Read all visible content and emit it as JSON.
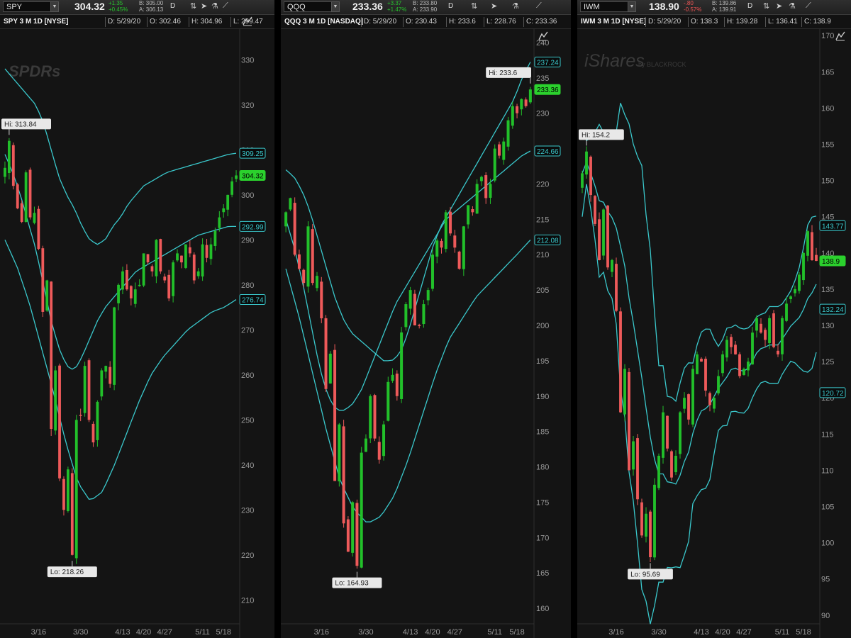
{
  "colors": {
    "up": "#22c02a",
    "down": "#ee5a5a",
    "band": "#3ac8cc",
    "bg": "#141414",
    "axis_text": "#9a9a9a"
  },
  "panels": [
    {
      "symbol": "SPY",
      "last": "304.32",
      "change": "+1.35",
      "change_pct": "+0.45%",
      "bid": "B: 305.00",
      "ask": "A: 306.13",
      "aggregation": "D",
      "title": "SPY 3 M 1D [NYSE]",
      "date": "D: 5/29/20",
      "open": "O: 302.46",
      "high": "H: 304.96",
      "low": "L: 299.47",
      "logo": "SPDRs",
      "hi_label": "Hi: 313.84",
      "lo_label": "Lo: 218.26",
      "price_badges": [
        {
          "value": "309.25",
          "type": "band"
        },
        {
          "value": "304.32",
          "type": "last"
        },
        {
          "value": "292.99",
          "type": "band"
        },
        {
          "value": "276.74",
          "type": "band"
        }
      ]
    },
    {
      "symbol": "QQQ",
      "last": "233.36",
      "change": "+3.37",
      "change_pct": "+1.47%",
      "bid": "B: 233.80",
      "ask": "A: 233.90",
      "aggregation": "D",
      "title": "QQQ 3 M 1D [NASDAQ]",
      "date": "D: 5/29/20",
      "open": "O: 230.43",
      "high": "H: 233.6",
      "low": "L: 228.76",
      "close": "C: 233.36",
      "hi_label": "Hi: 233.6",
      "lo_label": "Lo: 164.93",
      "price_badges": [
        {
          "value": "237.24",
          "type": "band"
        },
        {
          "value": "233.36",
          "type": "last"
        },
        {
          "value": "224.66",
          "type": "band"
        },
        {
          "value": "212.08",
          "type": "band"
        }
      ]
    },
    {
      "symbol": "IWM",
      "last": "138.90",
      "change": "-.80",
      "change_pct": "-0.57%",
      "bid": "B: 139.86",
      "ask": "A: 139.91",
      "aggregation": "D",
      "title": "IWM 3 M 1D [NYSE]",
      "date": "D: 5/29/20",
      "open": "O: 138.3",
      "high": "H: 139.28",
      "low": "L: 136.41",
      "close": "C: 138.9",
      "logo": "iShares",
      "logo_sub": "by BLACKROCK",
      "hi_label": "Hi: 154.2",
      "lo_label": "Lo: 95.69",
      "price_badges": [
        {
          "value": "143.77",
          "type": "band"
        },
        {
          "value": "138.9",
          "type": "last"
        },
        {
          "value": "132.24",
          "type": "band"
        },
        {
          "value": "120.72",
          "type": "band"
        }
      ]
    }
  ],
  "chart_data": [
    {
      "type": "candlestick",
      "title": "SPY 3 M 1D [NYSE]",
      "x_ticks": [
        "3/16",
        "3/30",
        "4/13",
        "4/20",
        "4/27",
        "5/11",
        "5/18"
      ],
      "x_tick_index": [
        8,
        18,
        28,
        33,
        38,
        47,
        52
      ],
      "y_ticks": [
        210,
        220,
        230,
        240,
        250,
        260,
        270,
        280,
        290,
        300,
        310,
        320,
        330
      ],
      "ylim": [
        205,
        337
      ],
      "n_bars": 56,
      "close": [
        306,
        312,
        302,
        297,
        294,
        305,
        295,
        296,
        288,
        274,
        281,
        248,
        261,
        237,
        230,
        239,
        220,
        250,
        251,
        262,
        250,
        245,
        254,
        261,
        262,
        258,
        275,
        280,
        283,
        279,
        277,
        279,
        280,
        287,
        285,
        283,
        290,
        283,
        281,
        277,
        285,
        287,
        285,
        289,
        287,
        281,
        283,
        289,
        286,
        289,
        292,
        295,
        297,
        300,
        303,
        304.32
      ],
      "upper_band": [
        328,
        326,
        324,
        322,
        320,
        316,
        310,
        304,
        300,
        297,
        293,
        290,
        289,
        290,
        293,
        295,
        298,
        300,
        302,
        303,
        304,
        305,
        305.5,
        306,
        306.5,
        307,
        307.5,
        308,
        308.5,
        309,
        309.25
      ],
      "middle_band": [
        309,
        305,
        300,
        294,
        288,
        280,
        272,
        266,
        262,
        261,
        264,
        268,
        272,
        275,
        277,
        279,
        281,
        283,
        284,
        285,
        286,
        287,
        288,
        289,
        290,
        291,
        291.5,
        292,
        292.5,
        293,
        292.99
      ],
      "lower_band": [
        290,
        284,
        276,
        266,
        256,
        245,
        236,
        232,
        234,
        240,
        247,
        254,
        260,
        264,
        267,
        270,
        272,
        274,
        275,
        276.74
      ]
    },
    {
      "type": "candlestick",
      "title": "QQQ 3 M 1D [NASDAQ]",
      "x_ticks": [
        "3/16",
        "3/30",
        "4/13",
        "4/20",
        "4/27",
        "5/11",
        "5/18"
      ],
      "x_tick_index": [
        8,
        18,
        28,
        33,
        38,
        47,
        52
      ],
      "y_ticks": [
        160,
        165,
        170,
        175,
        180,
        185,
        190,
        195,
        200,
        205,
        210,
        215,
        220,
        225,
        230,
        235,
        240
      ],
      "ylim": [
        158,
        242
      ],
      "n_bars": 56,
      "close": [
        216,
        218,
        210,
        208,
        206,
        214,
        206,
        207,
        201,
        191,
        196,
        178,
        186,
        172,
        168,
        175,
        166,
        182,
        184,
        190,
        184,
        181,
        186,
        192,
        193,
        190,
        199,
        203,
        205,
        200,
        200,
        203,
        205,
        210,
        212,
        211,
        216,
        213,
        211,
        208,
        214,
        217,
        216,
        220,
        221,
        218,
        220,
        225,
        224,
        226,
        229,
        231,
        230,
        232,
        231,
        233.36
      ],
      "upper_band": [
        222,
        221,
        219,
        216,
        212,
        208,
        204,
        201,
        199,
        198,
        197,
        196,
        195,
        195,
        196,
        199,
        203,
        207,
        211,
        214,
        216,
        218,
        220,
        222,
        224,
        226,
        228,
        230,
        232,
        235,
        237.24
      ],
      "middle_band": [
        215,
        211,
        206,
        200,
        194,
        190,
        188,
        188,
        189,
        191,
        194,
        197,
        200,
        203,
        205,
        207,
        209,
        211,
        213,
        215,
        216,
        217,
        218,
        219,
        220,
        221,
        222,
        223,
        224,
        224.66
      ],
      "lower_band": [
        208,
        201,
        193,
        185,
        178,
        174,
        172,
        173,
        176,
        181,
        187,
        193,
        198,
        201,
        204,
        206,
        208,
        210,
        212.08
      ]
    },
    {
      "type": "candlestick",
      "title": "IWM 3 M 1D [NYSE]",
      "x_ticks": [
        "3/16",
        "3/30",
        "4/13",
        "4/20",
        "4/27",
        "5/11",
        "5/18"
      ],
      "x_tick_index": [
        8,
        18,
        28,
        33,
        38,
        47,
        52
      ],
      "y_ticks": [
        90,
        95,
        100,
        105,
        110,
        115,
        120,
        125,
        130,
        135,
        140,
        145,
        150,
        155,
        160,
        165,
        170
      ],
      "ylim": [
        89,
        171
      ],
      "n_bars": 56,
      "close": [
        151,
        154,
        148,
        144,
        139,
        146,
        138,
        139,
        132,
        118,
        124,
        110,
        114,
        106,
        101,
        104,
        98,
        108,
        112,
        118,
        113,
        109,
        112,
        118,
        120,
        117,
        124,
        126,
        125,
        121,
        119,
        120,
        123,
        126,
        128,
        127,
        126,
        123,
        124,
        125,
        129,
        131,
        129,
        128,
        131,
        127,
        126,
        131,
        133,
        134,
        135,
        137,
        140,
        143,
        139,
        138.9
      ]
    }
  ]
}
